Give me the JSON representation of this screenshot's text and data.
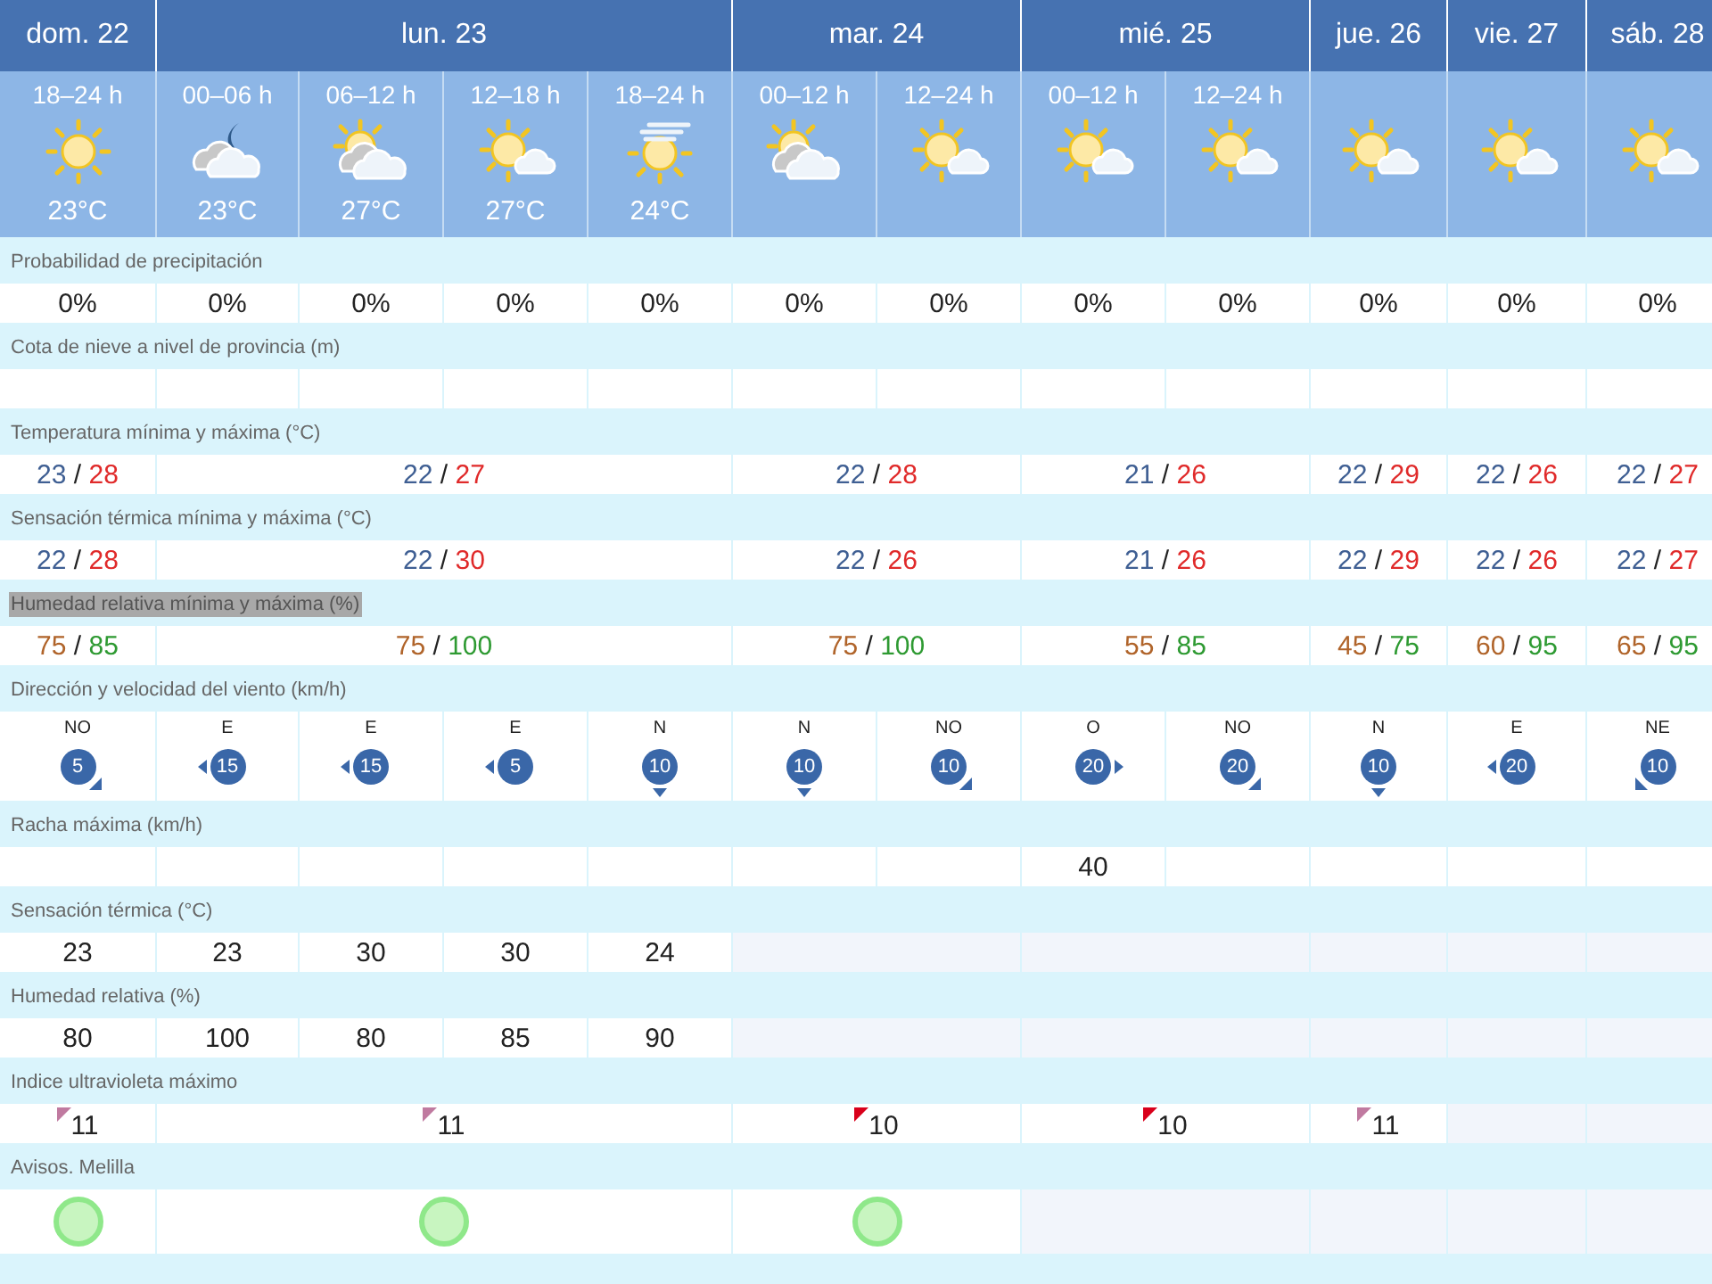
{
  "days": [
    {
      "label": "dom. 22",
      "periods": [
        {
          "label": "18–24 h",
          "kind": "sun",
          "temp": "23°C"
        }
      ]
    },
    {
      "label": "lun. 23",
      "periods": [
        {
          "label": "00–06 h",
          "kind": "night-clouds",
          "temp": "23°C"
        },
        {
          "label": "06–12 h",
          "kind": "sun-clouds",
          "temp": "27°C"
        },
        {
          "label": "12–18 h",
          "kind": "sun-cloud",
          "temp": "27°C"
        },
        {
          "label": "18–24 h",
          "kind": "sun-haze",
          "temp": "24°C"
        }
      ]
    },
    {
      "label": "mar. 24",
      "periods": [
        {
          "label": "00–12 h",
          "kind": "sun-clouds"
        },
        {
          "label": "12–24 h",
          "kind": "sun-cloud"
        }
      ]
    },
    {
      "label": "mié. 25",
      "periods": [
        {
          "label": "00–12 h",
          "kind": "sun-cloud"
        },
        {
          "label": "12–24 h",
          "kind": "sun-cloud"
        }
      ]
    },
    {
      "label": "jue. 26",
      "periods": [
        {
          "kind": "sun-cloud"
        }
      ]
    },
    {
      "label": "vie. 27",
      "periods": [
        {
          "kind": "sun-cloud"
        }
      ]
    },
    {
      "label": "sáb. 28",
      "periods": [
        {
          "kind": "sun-cloud"
        }
      ]
    }
  ],
  "sections": [
    {
      "title": "Probabilidad de precipitación",
      "kind": "text",
      "cells": [
        {
          "value": "0%"
        },
        {
          "value": "0%"
        },
        {
          "value": "0%"
        },
        {
          "value": "0%"
        },
        {
          "value": "0%"
        },
        {
          "value": "0%"
        },
        {
          "value": "0%"
        },
        {
          "value": "0%"
        },
        {
          "value": "0%"
        },
        {
          "value": "0%"
        },
        {
          "value": "0%"
        },
        {
          "value": "0%"
        }
      ]
    },
    {
      "title": "Cota de nieve a nivel de provincia (m)",
      "kind": "text",
      "cells": [
        {},
        {},
        {},
        {},
        {},
        {},
        {},
        {},
        {},
        {},
        {},
        {}
      ]
    },
    {
      "title": "Temperatura mínima y máxima (°C)",
      "kind": "temperature-range",
      "cells": [
        {
          "min": "23",
          "separator": "/",
          "max": "28"
        },
        {
          "min": "22",
          "separator": "/",
          "max": "27"
        },
        {
          "min": "22",
          "separator": "/",
          "max": "28"
        },
        {
          "min": "21",
          "separator": "/",
          "max": "26"
        },
        {
          "min": "22",
          "separator": "/",
          "max": "29"
        },
        {
          "min": "22",
          "separator": "/",
          "max": "26"
        },
        {
          "min": "22",
          "separator": "/",
          "max": "27"
        }
      ]
    },
    {
      "title": "Sensación térmica mínima y máxima (°C)",
      "kind": "temperature-range",
      "cells": [
        {
          "min": "22",
          "separator": "/",
          "max": "28"
        },
        {
          "min": "22",
          "separator": "/",
          "max": "30"
        },
        {
          "min": "22",
          "separator": "/",
          "max": "26"
        },
        {
          "min": "21",
          "separator": "/",
          "max": "26"
        },
        {
          "min": "22",
          "separator": "/",
          "max": "29"
        },
        {
          "min": "22",
          "separator": "/",
          "max": "26"
        },
        {
          "min": "22",
          "separator": "/",
          "max": "27"
        }
      ]
    },
    {
      "title": "Humedad relativa mínima y máxima (%)",
      "highlighted": true,
      "kind": "humidity-range",
      "cells": [
        {
          "min": "75",
          "separator": "/",
          "max": "85"
        },
        {
          "min": "75",
          "separator": "/",
          "max": "100"
        },
        {
          "min": "75",
          "separator": "/",
          "max": "100"
        },
        {
          "min": "55",
          "separator": "/",
          "max": "85"
        },
        {
          "min": "45",
          "separator": "/",
          "max": "75"
        },
        {
          "min": "60",
          "separator": "/",
          "max": "95"
        },
        {
          "min": "65",
          "separator": "/",
          "max": "95"
        }
      ]
    },
    {
      "title": "Dirección y velocidad del viento (km/h)",
      "kind": "wind",
      "cells": [
        {
          "direction": "NO",
          "speed": "5",
          "kind": "southeast"
        },
        {
          "direction": "E",
          "speed": "15",
          "kind": "west"
        },
        {
          "direction": "E",
          "speed": "15",
          "kind": "west"
        },
        {
          "direction": "E",
          "speed": "5",
          "kind": "west"
        },
        {
          "direction": "N",
          "speed": "10",
          "kind": "south"
        },
        {
          "direction": "N",
          "speed": "10",
          "kind": "south"
        },
        {
          "direction": "NO",
          "speed": "10",
          "kind": "southeast"
        },
        {
          "direction": "O",
          "speed": "20",
          "kind": "east"
        },
        {
          "direction": "NO",
          "speed": "20",
          "kind": "southeast"
        },
        {
          "direction": "N",
          "speed": "10",
          "kind": "south"
        },
        {
          "direction": "E",
          "speed": "20",
          "kind": "west"
        },
        {
          "direction": "NE",
          "speed": "10",
          "kind": "southwest"
        }
      ]
    },
    {
      "title": "Racha máxima (km/h)",
      "kind": "text",
      "cells": [
        {},
        {},
        {},
        {},
        {},
        {},
        {},
        {
          "value": "40"
        },
        {},
        {},
        {},
        {}
      ]
    },
    {
      "title": "Sensación térmica (°C)",
      "kind": "text",
      "cells": [
        {
          "value": "23"
        },
        {
          "value": "23"
        },
        {
          "value": "30"
        },
        {
          "value": "30"
        },
        {
          "value": "24"
        },
        {
          "no_data": true
        },
        {
          "no_data": true
        },
        {
          "no_data": true
        },
        {
          "no_data": true
        },
        {
          "no_data": true
        }
      ]
    },
    {
      "title": "Humedad relativa (%)",
      "kind": "text",
      "cells": [
        {
          "value": "80"
        },
        {
          "value": "100"
        },
        {
          "value": "80"
        },
        {
          "value": "85"
        },
        {
          "value": "90"
        },
        {
          "no_data": true
        },
        {
          "no_data": true
        },
        {
          "no_data": true
        },
        {
          "no_data": true
        },
        {
          "no_data": true
        }
      ]
    },
    {
      "title": "Indice ultravioleta máximo",
      "kind": "uv",
      "cells": [
        {
          "value": "11",
          "color": "#c07aa0"
        },
        {
          "value": "11",
          "color": "#c07aa0"
        },
        {
          "value": "10",
          "color": "#d9001b"
        },
        {
          "value": "10",
          "color": "#d9001b"
        },
        {
          "value": "11",
          "color": "#c07aa0"
        },
        {
          "no_data": true
        },
        {
          "no_data": true
        }
      ]
    },
    {
      "title": "Avisos. Melilla",
      "kind": "warning",
      "cells": [
        {
          "color": "#c8f5c0"
        },
        {
          "color": "#c8f5c0"
        },
        {
          "color": "#c8f5c0"
        },
        {
          "no_data": true
        },
        {
          "no_data": true
        },
        {
          "no_data": true
        },
        {
          "no_data": true
        }
      ]
    }
  ]
}
